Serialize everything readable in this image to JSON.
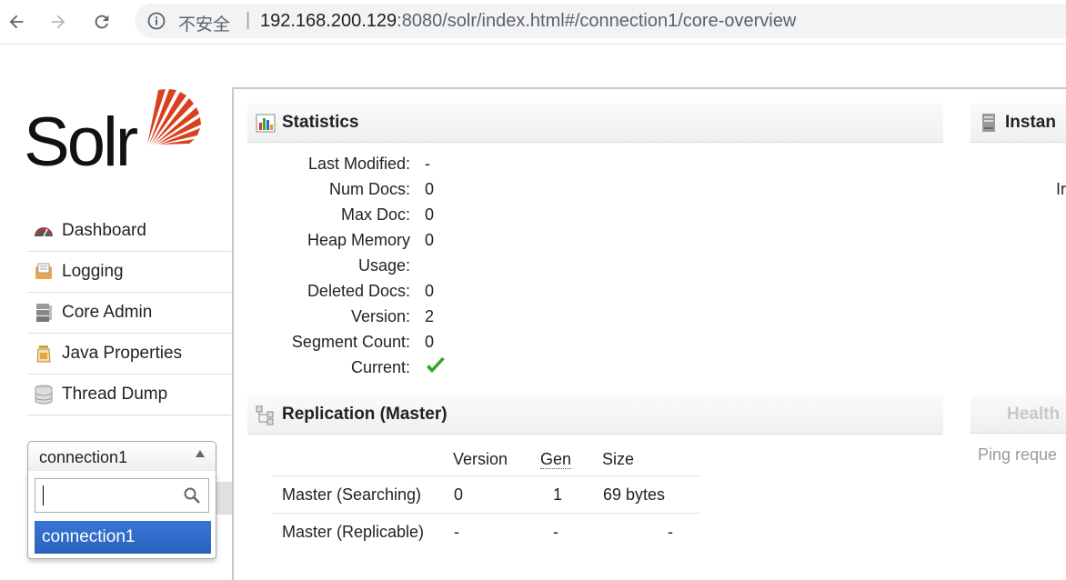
{
  "browser": {
    "security_label": "不安全",
    "separator": "|",
    "url_host": "192.168.200.129",
    "url_rest": ":8080/solr/index.html#/connection1/core-overview"
  },
  "logo": {
    "text": "Solr",
    "brand_color": "#d9411e"
  },
  "sidebar": {
    "items": [
      {
        "label": "Dashboard",
        "icon": "dashboard-icon"
      },
      {
        "label": "Logging",
        "icon": "logging-icon"
      },
      {
        "label": "Core Admin",
        "icon": "core-admin-icon"
      },
      {
        "label": "Java Properties",
        "icon": "java-properties-icon"
      },
      {
        "label": "Thread Dump",
        "icon": "thread-dump-icon"
      }
    ],
    "core_selector": {
      "selected": "connection1",
      "search_value": "",
      "options": [
        "connection1"
      ]
    }
  },
  "statistics": {
    "title": "Statistics",
    "rows": [
      {
        "label": "Last Modified:",
        "value": "-"
      },
      {
        "label": "Num Docs:",
        "value": "0"
      },
      {
        "label": "Max Doc:",
        "value": "0"
      },
      {
        "label": "Heap Memory",
        "value": "0"
      },
      {
        "label": "Usage:",
        "value": ""
      },
      {
        "label": "Deleted Docs:",
        "value": "0"
      },
      {
        "label": "Version:",
        "value": "2"
      },
      {
        "label": "Segment Count:",
        "value": "0"
      },
      {
        "label": "Current:",
        "value": ""
      }
    ]
  },
  "replication": {
    "title": "Replication (Master)",
    "headers": [
      "Version",
      "Gen",
      "Size"
    ],
    "rows": [
      {
        "name": "Master (Searching)",
        "version": "0",
        "gen": "1",
        "size": "69 bytes"
      },
      {
        "name": "Master (Replicable)",
        "version": "-",
        "gen": "-",
        "size": "-"
      }
    ]
  },
  "instance": {
    "title": "Instan",
    "fragment": "Ir"
  },
  "healthcheck": {
    "title": "Health",
    "ping_text": "Ping reque"
  }
}
